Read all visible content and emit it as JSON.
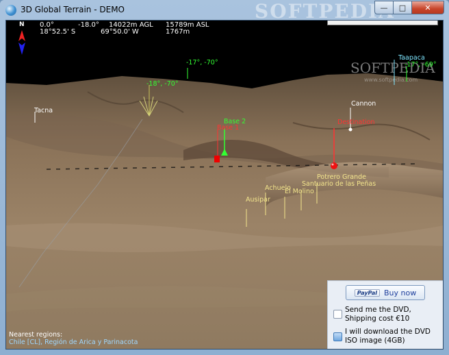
{
  "window": {
    "title": "3D Global Terrain - DEMO",
    "watermark": "SOFTPEDIA",
    "controls": {
      "minimize": "—",
      "maximize": "□",
      "close": "✕"
    }
  },
  "hud": {
    "north": "N",
    "row1": {
      "heading": "0.0°",
      "pitch": "-18.0°",
      "agl": "14022m AGL",
      "asl": "15789m ASL"
    },
    "row2": {
      "lat": "18°52.5' S",
      "lon": "69°50.0' W",
      "elevation": "1767m"
    }
  },
  "watermark": {
    "brand": "SOFTPEDIA",
    "url": "www.softpedia.com"
  },
  "markers": [
    {
      "id": "tacna",
      "label": "Tacna",
      "color": "#ffffff"
    },
    {
      "id": "grid1",
      "label": "-17°, -70°",
      "color": "#33ff33"
    },
    {
      "id": "grid2",
      "label": "-18°, -70°",
      "color": "#33ff33"
    },
    {
      "id": "taapaca",
      "label": "Taapaca",
      "color": "#7fe6ff"
    },
    {
      "id": "grid3",
      "label": "-17°, -69°",
      "color": "#33ff33"
    },
    {
      "id": "cannon",
      "label": "Cannon",
      "color": "#ffffff"
    },
    {
      "id": "base2",
      "label": "Base 2",
      "color": "#33ff33"
    },
    {
      "id": "base1",
      "label": "Base 1",
      "color": "#ff3333"
    },
    {
      "id": "destination",
      "label": "Destination",
      "color": "#ff3333"
    },
    {
      "id": "potrero",
      "label": "Potrero Grande",
      "color": "#f3e58c"
    },
    {
      "id": "santuario",
      "label": "Santuario de las Peñas",
      "color": "#f3e58c"
    },
    {
      "id": "achuelo",
      "label": "Achuelo",
      "color": "#f3e58c"
    },
    {
      "id": "molino",
      "label": "El Molino",
      "color": "#f3e58c"
    },
    {
      "id": "ausipar",
      "label": "Ausipar",
      "color": "#f3e58c"
    }
  ],
  "nearest": {
    "heading": "Nearest regions:",
    "value": "Chile [CL], Región de Arica y Parinacota"
  },
  "purchase": {
    "paypal": "PayPal",
    "buy_label": "Buy now",
    "option_dvd": "Send me the DVD, Shipping cost €10",
    "option_iso": "I will download the DVD ISO image (4GB)"
  }
}
